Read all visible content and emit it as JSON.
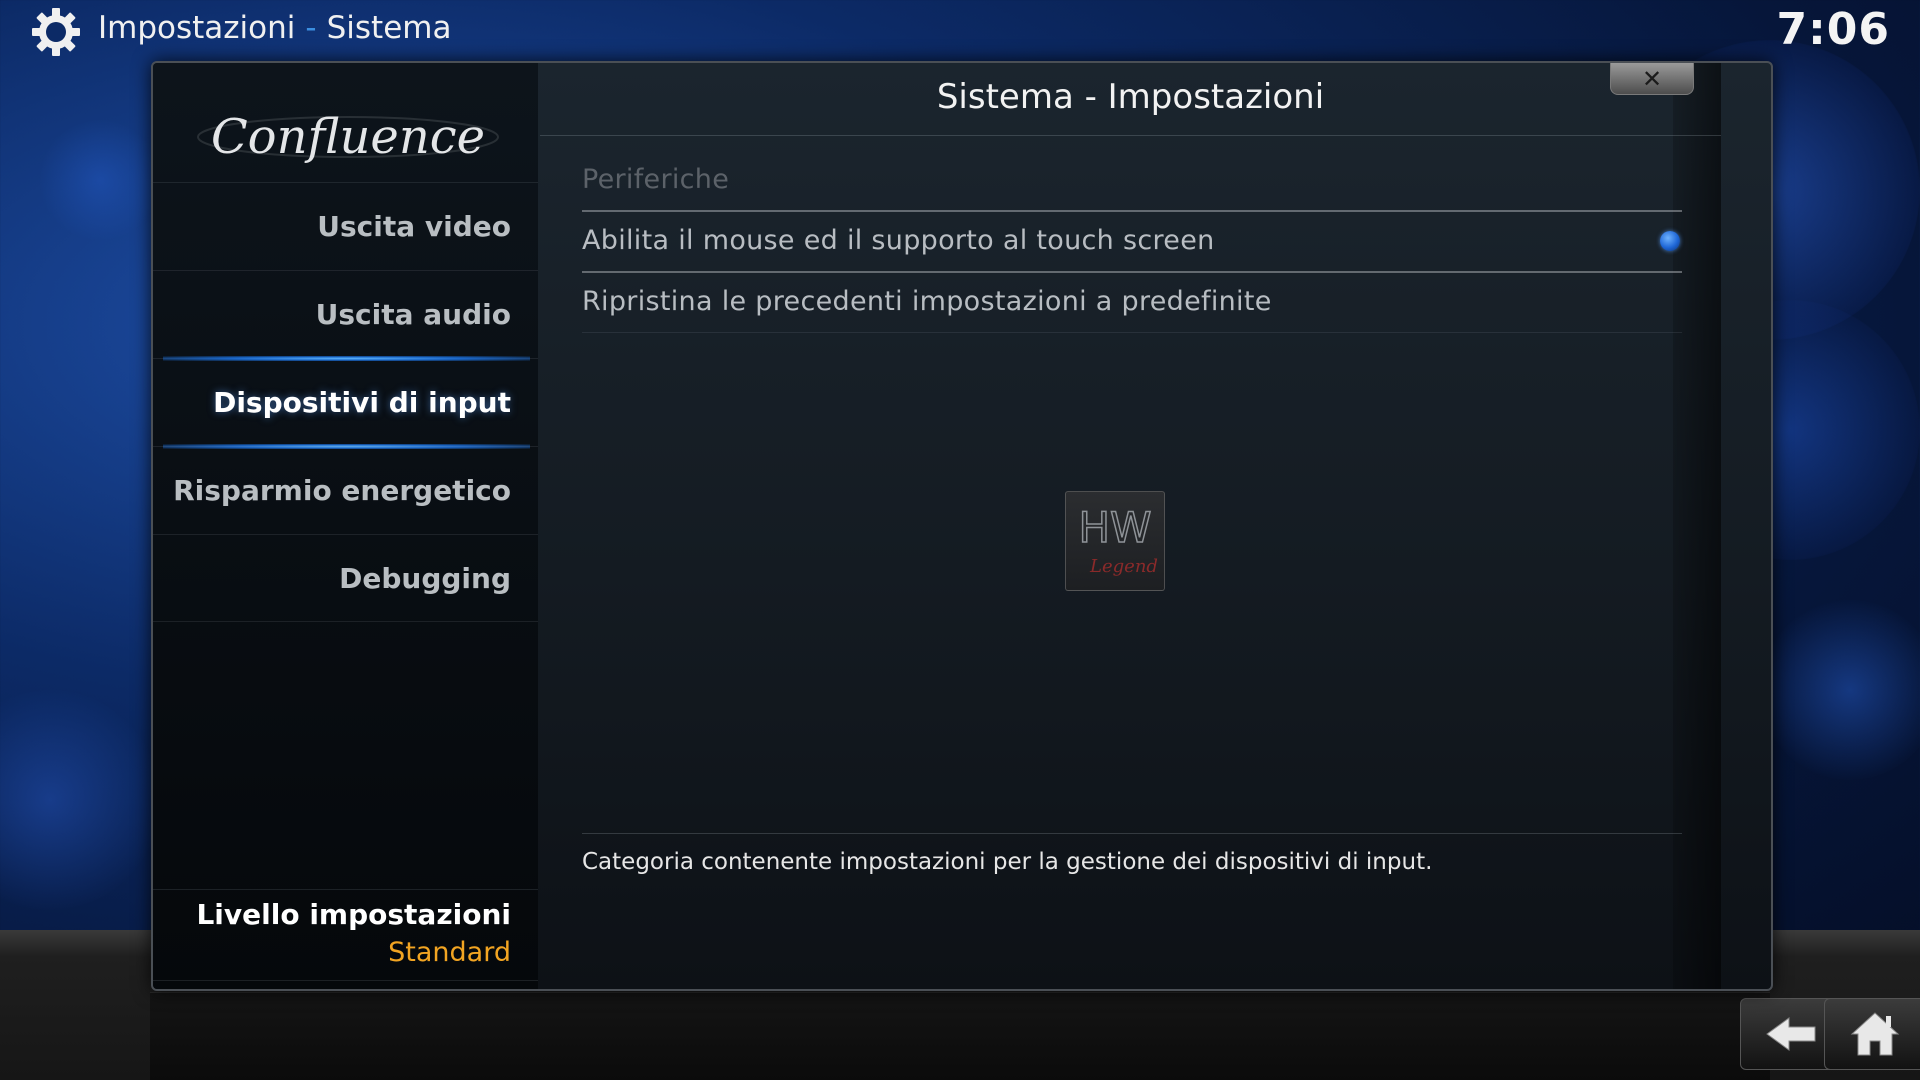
{
  "header": {
    "section": "Impostazioni",
    "separator": "-",
    "page": "Sistema",
    "clock": "7:06"
  },
  "sidebar": {
    "logo_text": "Confluence",
    "items": [
      {
        "label": "Uscita video",
        "active": false
      },
      {
        "label": "Uscita audio",
        "active": false
      },
      {
        "label": "Dispositivi di input",
        "active": true
      },
      {
        "label": "Risparmio energetico",
        "active": false
      },
      {
        "label": "Debugging",
        "active": false
      }
    ],
    "settings_level": {
      "label": "Livello impostazioni",
      "value": "Standard"
    }
  },
  "dialog": {
    "title": "Sistema - Impostazioni",
    "close_icon": "close-icon",
    "settings": [
      {
        "label": "Periferiche",
        "type": "category"
      },
      {
        "label": "Abilita il mouse ed il supporto al touch screen",
        "type": "toggle",
        "enabled": true
      },
      {
        "label": "Ripristina le precedenti impostazioni a predefinite",
        "type": "action"
      }
    ],
    "description": "Categoria contenente impostazioni per la gestione dei dispositivi di input.",
    "watermark_text": [
      "HW",
      "Legend"
    ]
  },
  "footer": {
    "back_icon": "back-arrow-icon",
    "home_icon": "home-icon"
  },
  "colors": {
    "accent_blue": "#3b8fe0",
    "level_value": "#f2a422"
  }
}
